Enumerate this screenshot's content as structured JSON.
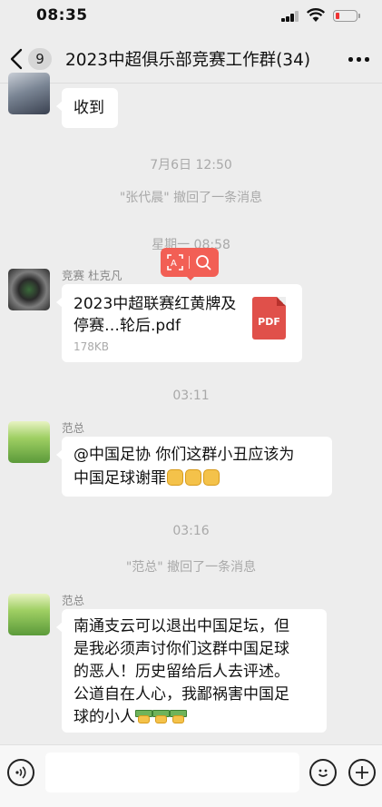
{
  "status_bar": {
    "time": "08:35"
  },
  "header": {
    "unread_count": "9",
    "title": "2023中超俱乐部竞赛工作群(34)"
  },
  "messages": {
    "m1": {
      "text": "收到"
    },
    "ts1": "7月6日 12:50",
    "recall1": "\"张代晨\" 撤回了一条消息",
    "ts2": "星期一 08:58",
    "m2": {
      "sender": "竞赛 杜克凡",
      "file_name": "2023中超联赛红黄牌及停赛…轮后.pdf",
      "file_size": "178KB",
      "file_icon": "PDF"
    },
    "ts3": "03:11",
    "m3": {
      "sender": "范总",
      "text_line1": "@中国足协 你们这群小丑应该为",
      "text_line2": "中国足球谢罪"
    },
    "ts4": "03:16",
    "recall2": "\"范总\" 撤回了一条消息",
    "m4": {
      "sender": "范总",
      "line1": "南通支云可以退出中国足坛，但",
      "line2": "是我必须声讨你们这群中国足球",
      "line3": "的恶人！历史留给后人去评述。",
      "line4": "公道自在人心，我鄙祸害中国足",
      "line5": "球的小人"
    }
  },
  "icons": {
    "back": "chevron-left-icon",
    "more": "more-dots-icon",
    "text_select": "text-recognize-icon",
    "search": "search-icon",
    "voice": "voice-icon",
    "emoji": "emoji-icon",
    "plus": "plus-icon",
    "pdf": "pdf-file-icon"
  },
  "colors": {
    "background": "#ededed",
    "bubble": "#ffffff",
    "toolbar": "#f25f55",
    "battery_low": "#e33333"
  }
}
